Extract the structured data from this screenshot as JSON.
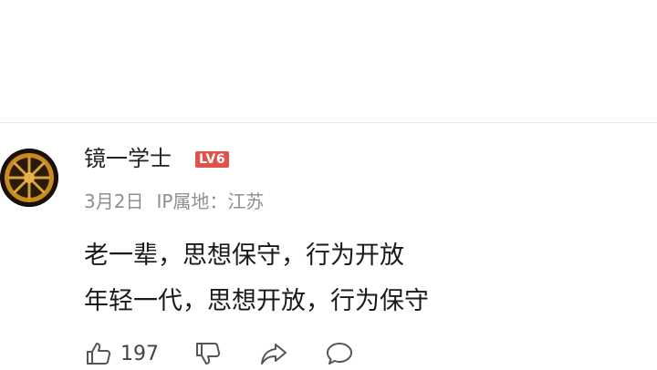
{
  "comment": {
    "username": "镜一学士",
    "level": "LV6",
    "date": "3月2日",
    "ip_location": "IP属地：江苏",
    "lines": [
      "老一辈，思想保守，行为开放",
      "年轻一代，思想开放，行为保守"
    ],
    "like_count": "197"
  },
  "icons": {
    "like": "thumbs-up-icon",
    "dislike": "thumbs-down-icon",
    "share": "share-icon",
    "reply": "comment-bubble-icon"
  },
  "colors": {
    "level_badge": "#e0524a",
    "meta_text": "#8f8f8f",
    "content_text": "#1a1a1a"
  }
}
